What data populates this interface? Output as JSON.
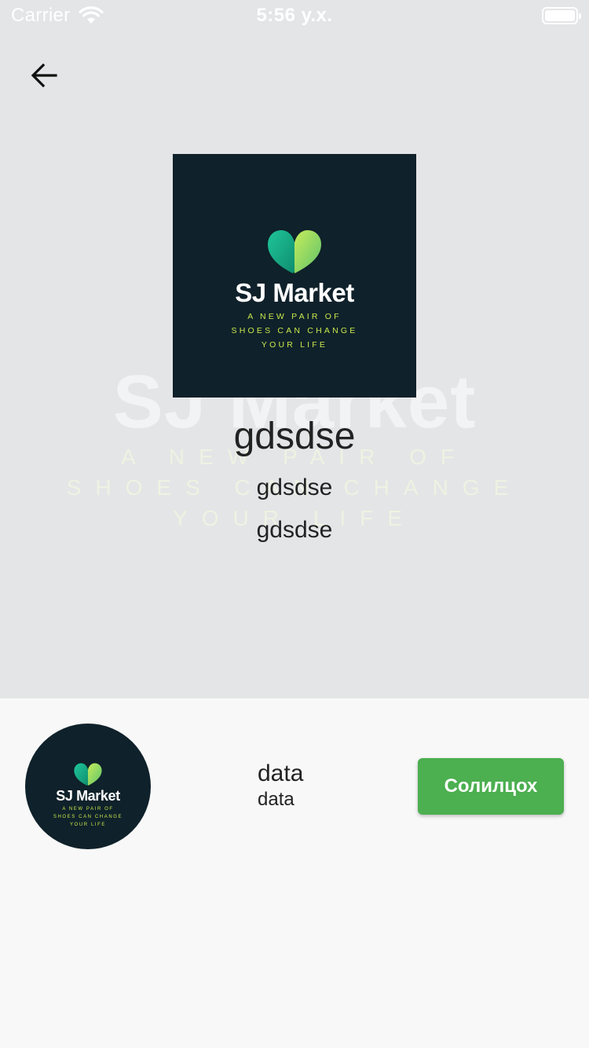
{
  "status_bar": {
    "carrier": "Carrier",
    "time": "5:56 у.х.",
    "wifi_icon": "wifi-icon",
    "battery_icon": "battery-icon",
    "battery_level": 1.0
  },
  "header": {
    "back_icon": "arrow-left-icon"
  },
  "brand": {
    "name": "SJ Market",
    "tagline_line1": "A NEW PAIR OF",
    "tagline_line2": "SHOES CAN CHANGE",
    "tagline_line3": "YOUR LIFE",
    "logo_icon": "heart-leaf-icon",
    "background_color": "#0f212a",
    "tagline_color": "#c8e84c"
  },
  "hero": {
    "title": "gdsdse",
    "subtitle1": "gdsdse",
    "subtitle2": "gdsdse",
    "background_color": "#e4e5e7"
  },
  "profile": {
    "title": "data",
    "subtitle": "data",
    "button_label": "Солилцох",
    "button_color": "#4caf50"
  }
}
